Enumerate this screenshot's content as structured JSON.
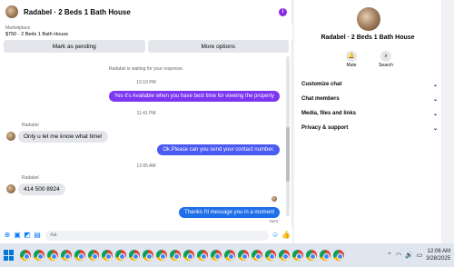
{
  "header": {
    "title": "Radabel · 2 Beds 1 Bath House",
    "info_icon": "info-icon"
  },
  "marketplace": {
    "label": "Marketplace",
    "listing": "$750 · 2 Beds 1 Bath House"
  },
  "actions": {
    "mark_pending": "Mark as pending",
    "more_options": "More options"
  },
  "messages": {
    "system_waiting": "Radabel is waiting for your response.",
    "time_1": "10:19 PM",
    "out_1": "Yes it's Available when you have best time for viewing the property",
    "time_2": "11:41 PM",
    "in_1_sender": "Radabel",
    "in_1": "Only u let me know what time!",
    "out_2": "Ok.Please can you send your contact number.",
    "time_3": "12:05 AM",
    "in_2_sender": "Radabel",
    "in_2": "414 500 8924",
    "out_3": "Thanks I'll message you in a moment",
    "sent_label": "Sent"
  },
  "compose": {
    "placeholder": "Aa"
  },
  "info_pane": {
    "name": "Radabel · 2 Beds 1 Bath House",
    "mute_label": "Mute",
    "search_label": "Search",
    "rows": [
      {
        "label": "Customize chat"
      },
      {
        "label": "Chat members"
      },
      {
        "label": "Media, files and links"
      },
      {
        "label": "Privacy & support"
      }
    ]
  },
  "taskbar": {
    "time": "12:06 AM",
    "date": "3/28/2025"
  },
  "colors": {
    "accent": "#8a2be2",
    "bubble_purple": "#7c35f0",
    "bubble_indigo": "#4b5bf2",
    "bubble_blue": "#1f6fe9"
  }
}
